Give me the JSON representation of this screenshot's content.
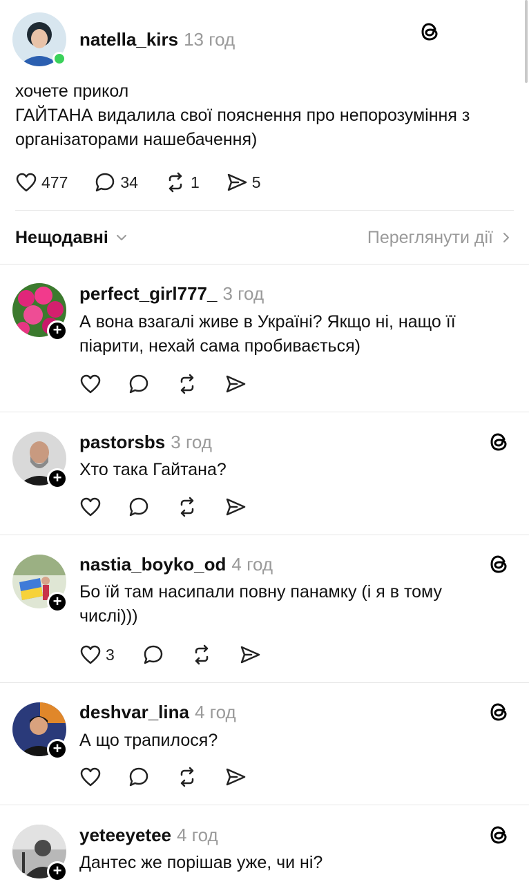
{
  "post": {
    "username": "natella_kirs",
    "time": "13 год",
    "text": [
      "хочете прикол",
      "ГАЙТАНА видалила свої пояснення про непорозуміння з",
      "організаторами нашебачення)"
    ],
    "likes": "477",
    "comments": "34",
    "reposts": "1",
    "shares": "5"
  },
  "sort": {
    "label": "Нещодавні",
    "view_activity": "Переглянути дії"
  },
  "replies": [
    {
      "username": "perfect_girl777_",
      "time": "3 год",
      "lines": [
        "А вона взагалі живе в Україні? Якщо ні, нащо її",
        "піарити, нехай сама пробивається)"
      ],
      "likes": ""
    },
    {
      "username": "pastorsbs",
      "time": "3 год",
      "lines": [
        "Хто така Гайтана?"
      ],
      "likes": ""
    },
    {
      "username": "nastia_boyko_od",
      "time": "4 год",
      "lines": [
        "Бо їй там насипали повну панамку (і я в тому",
        "числі)))"
      ],
      "likes": "3"
    },
    {
      "username": "deshvar_lina",
      "time": "4 год",
      "lines": [
        "А що трапилося?"
      ],
      "likes": ""
    },
    {
      "username": "yeteeyetee",
      "time": "4 год",
      "lines": [
        "Дантес же порішав уже, чи ні?"
      ],
      "likes": ""
    }
  ],
  "icons": {
    "like": "heart-icon",
    "comment": "comment-icon",
    "repost": "repost-icon",
    "share": "send-icon",
    "threads": "threads-logo-icon",
    "follow": "plus-icon"
  }
}
